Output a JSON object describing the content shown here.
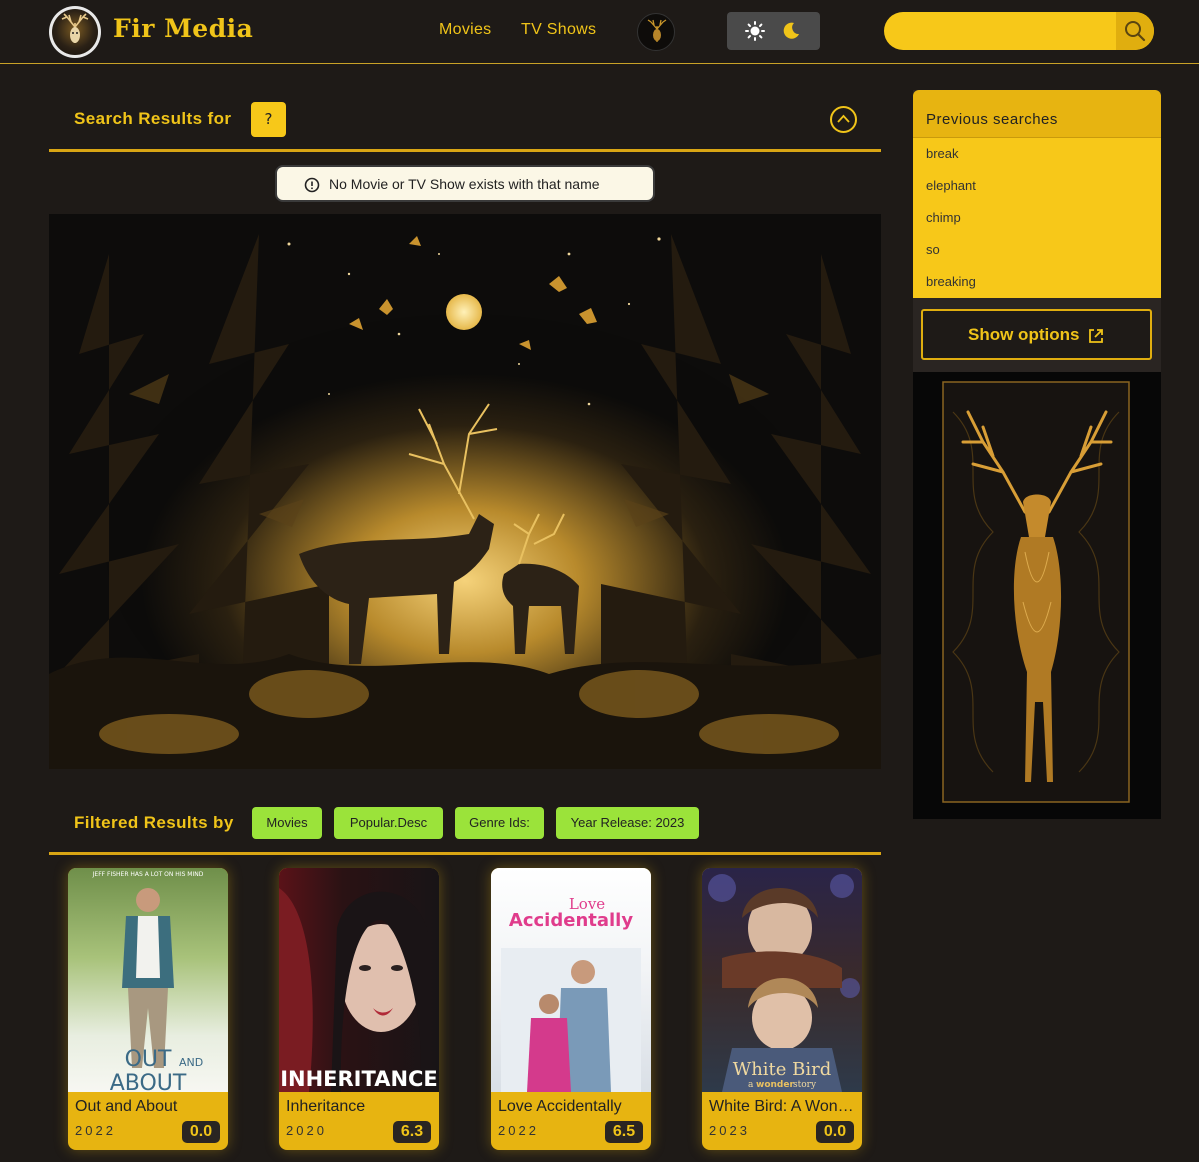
{
  "header": {
    "brand": "Fir Media",
    "nav": {
      "movies": "Movies",
      "tv_shows": "TV Shows"
    },
    "search": {
      "value": "",
      "placeholder": ""
    },
    "accent": "#f0c419"
  },
  "search_results": {
    "title": "Search Results for",
    "query": "?",
    "alert": "No Movie or TV Show exists with that name"
  },
  "sidebar": {
    "previous_searches_title": "Previous searches",
    "previous_searches": [
      "break",
      "elephant",
      "chimp",
      "so",
      "breaking"
    ],
    "show_options_label": "Show options"
  },
  "filtered": {
    "title": "Filtered Results by",
    "chips": [
      "Movies",
      "Popular.Desc",
      "Genre Ids:",
      "Year Release: 2023"
    ],
    "chip_color": "#9be33a"
  },
  "cards": [
    {
      "title": "Out and About",
      "year": "2022",
      "rating": "0.0",
      "poster_text_top": "JEFF FISHER HAS A LOT ON HIS MIND",
      "poster_text_main": "OUT",
      "poster_text_and": "AND",
      "poster_text_sub": "ABOUT"
    },
    {
      "title": "Inheritance",
      "year": "2020",
      "rating": "6.3",
      "poster_text_main": "INHERITANCE"
    },
    {
      "title": "Love Accidentally",
      "year": "2022",
      "rating": "6.5",
      "poster_text_top": "Love",
      "poster_text_main": "Accidentally"
    },
    {
      "title": "White Bird: A Wonder Story",
      "year": "2023",
      "rating": "0.0",
      "poster_text_main": "White Bird",
      "poster_text_a": "a",
      "poster_text_wonder": "wonder",
      "poster_text_sub": "story"
    }
  ]
}
